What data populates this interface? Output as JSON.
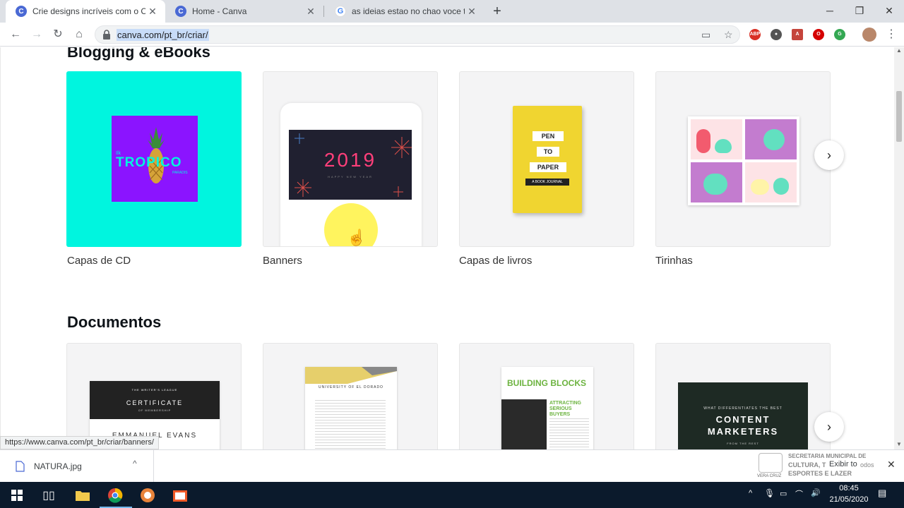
{
  "tabs": [
    {
      "title": "Crie designs incríveis com o Canva",
      "icon": "canva-favicon",
      "active": true
    },
    {
      "title": "Home - Canva",
      "icon": "canva-favicon",
      "active": false
    },
    {
      "title": "as ideias estao no chao voce tropeça",
      "icon": "google-favicon",
      "active": false
    }
  ],
  "toolbar": {
    "url": "canva.com/pt_br/criar/"
  },
  "sections": [
    {
      "title": "Blogging & eBooks",
      "cards": [
        {
          "label": "Capas de CD",
          "art_text": "TROPICO",
          "art_small_left": "Ilk",
          "art_small_right": "PARADIS"
        },
        {
          "label": "Banners",
          "art_text": "2019",
          "art_sub": "HAPPY NEW YEAR"
        },
        {
          "label": "Capas de livros",
          "art_lines": [
            "PEN",
            "TO",
            "PAPER"
          ],
          "art_sub": "A BOOK JOURNAL"
        },
        {
          "label": "Tirinhas"
        }
      ]
    },
    {
      "title": "Documentos",
      "cards": [
        {
          "art_header": "THE WRITER'S LEAGUE",
          "art_title": "CERTIFICATE",
          "art_sub": "OF MEMBERSHIP",
          "art_name": "EMMANUEL EVANS"
        },
        {
          "art_title": "UNIVERSITY OF EL DORADO"
        },
        {
          "art_title": "BUILDING BLOCKS",
          "art_sub": "ATTRACTING SERIOUS BUYERS"
        },
        {
          "art_header": "WHAT DIFFERENTIATES THE BEST",
          "art_title": "CONTENT MARKETERS",
          "art_sub": "FROM THE REST"
        }
      ]
    }
  ],
  "status_url": "https://www.canva.com/pt_br/criar/banners/",
  "download": {
    "filename": "NATURA.jpg"
  },
  "notification": {
    "line1": "SECRETARIA MUNICIPAL DE",
    "line2": "CULTURA, T",
    "line2b": "odos",
    "line3": "ESPORTES E LAZER",
    "overlay": "Exibir to",
    "city": "VERA CRUZ"
  },
  "clock": {
    "time": "08:45",
    "date": "21/05/2020"
  },
  "colors": {
    "canva_blue": "#4a69d4",
    "cd_bg": "#00f5df",
    "cd_inner": "#8b14ff"
  }
}
